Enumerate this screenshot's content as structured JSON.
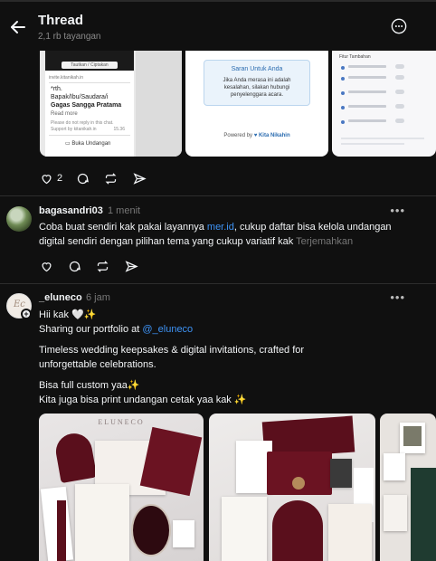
{
  "header": {
    "title": "Thread",
    "views": "2,1 rb tayangan"
  },
  "top_post": {
    "card1": {
      "chip": "Tautkan / Ciptakan",
      "url": "invite.kitanikah.in",
      "greeting": "*rth.",
      "names_line": "Bapak/Ibu/Saudara/i",
      "name_bold": "Gagas Sangga Pratama",
      "read_more": "Read more",
      "no_reply": "Please do not reply in this chat.",
      "support": "Support by kitanikah.in",
      "time": "15.36",
      "open_button": "Buka Undangan"
    },
    "card2": {
      "note_title": "Saran Untuk Anda",
      "note_body": "Jika Anda merasa ini adalah kesalahan, silakan hubungi penyelenggara acara.",
      "powered_prefix": "Powered by",
      "powered_brand": "Kita Nikahin"
    },
    "card3": {
      "pane_title": "Fitur Tambahan"
    },
    "actions": {
      "like_count": "2"
    }
  },
  "reply1": {
    "username": "bagasandri03",
    "time": "1 menit",
    "text_before": "Coba buat sendiri kak pakai layannya ",
    "link": "mer.id",
    "text_after": ", cukup daftar bisa kelola undangan digital sendiri dengan pilihan tema yang cukup variatif kak",
    "translate": "Terjemahkan"
  },
  "reply2": {
    "username": "_eluneco",
    "time": "6 jam",
    "line1": "Hii kak 🤍✨",
    "line2_prefix": "Sharing our portfolio at ",
    "line2_link": "@_eluneco",
    "para2": "Timeless wedding keepsakes & digital invitations, crafted for unforgettable celebrations.",
    "para3_line1": "Bisa full custom yaa✨",
    "para3_line2": "Kita juga bisa print undangan cetak yaa kak ✨",
    "brand": "ELUNECO",
    "avatar_monogram": "Ec"
  },
  "colors": {
    "background": "#101010",
    "text": "#f3f5f7",
    "muted": "#777777",
    "link": "#3e93f5",
    "burgundy": "#5a0f1c"
  }
}
